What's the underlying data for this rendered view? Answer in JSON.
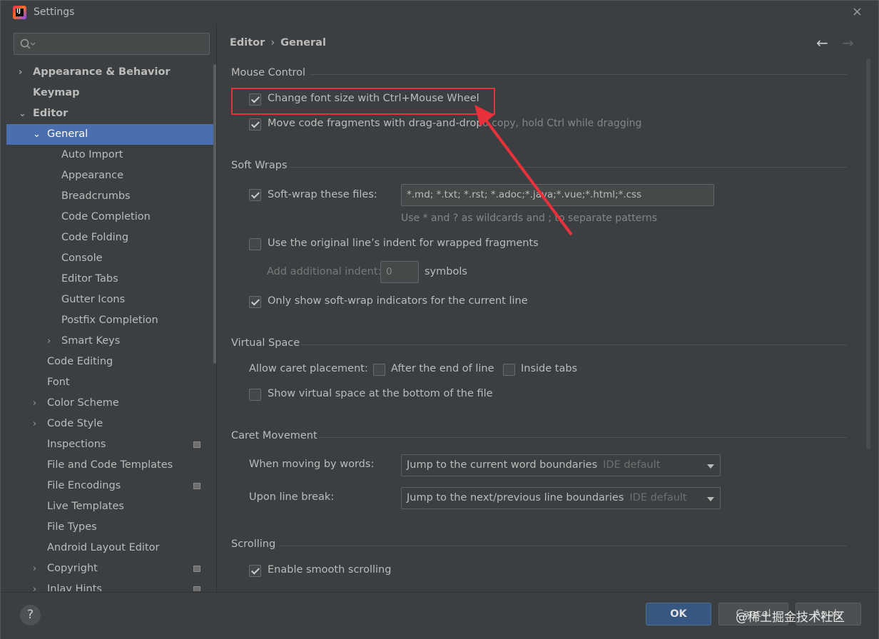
{
  "window": {
    "title": "Settings",
    "close": "×"
  },
  "search": {
    "placeholder": ""
  },
  "tree": [
    {
      "label": "Appearance & Behavior",
      "bold": true,
      "arrow": "›",
      "indent": 0
    },
    {
      "label": "Keymap",
      "bold": true,
      "indent": 0
    },
    {
      "label": "Editor",
      "bold": true,
      "arrow": "⌄",
      "indent": 0
    },
    {
      "label": "General",
      "arrow": "⌄",
      "indent": 1,
      "selected": true
    },
    {
      "label": "Auto Import",
      "indent": 2
    },
    {
      "label": "Appearance",
      "indent": 2
    },
    {
      "label": "Breadcrumbs",
      "indent": 2
    },
    {
      "label": "Code Completion",
      "indent": 2
    },
    {
      "label": "Code Folding",
      "indent": 2
    },
    {
      "label": "Console",
      "indent": 2
    },
    {
      "label": "Editor Tabs",
      "indent": 2
    },
    {
      "label": "Gutter Icons",
      "indent": 2
    },
    {
      "label": "Postfix Completion",
      "indent": 2
    },
    {
      "label": "Smart Keys",
      "arrow": "›",
      "indent": 2
    },
    {
      "label": "Code Editing",
      "indent": 1
    },
    {
      "label": "Font",
      "indent": 1
    },
    {
      "label": "Color Scheme",
      "arrow": "›",
      "indent": 1
    },
    {
      "label": "Code Style",
      "arrow": "›",
      "indent": 1
    },
    {
      "label": "Inspections",
      "indent": 1,
      "icon": true
    },
    {
      "label": "File and Code Templates",
      "indent": 1
    },
    {
      "label": "File Encodings",
      "indent": 1,
      "icon": true
    },
    {
      "label": "Live Templates",
      "indent": 1
    },
    {
      "label": "File Types",
      "indent": 1
    },
    {
      "label": "Android Layout Editor",
      "indent": 1
    },
    {
      "label": "Copyright",
      "arrow": "›",
      "indent": 1,
      "icon": true
    },
    {
      "label": "Inlay Hints",
      "arrow": "›",
      "indent": 1,
      "icon": true
    }
  ],
  "breadcrumb": {
    "root": "Editor",
    "sep": "›",
    "current": "General"
  },
  "nav": {
    "back": "←",
    "forward": "→"
  },
  "mouse_control": {
    "title": "Mouse Control",
    "font_size_ctrl_wheel": {
      "label": "Change font size with Ctrl+Mouse Wheel",
      "checked": true
    },
    "drag_drop": {
      "label": "Move code fragments with drag-and-drop",
      "hint": "To copy, hold Ctrl while dragging",
      "checked": true
    }
  },
  "soft_wraps": {
    "title": "Soft Wraps",
    "soft_wrap_files": {
      "label": "Soft-wrap these files:",
      "checked": true,
      "value": "*.md; *.txt; *.rst; *.adoc;*.java;*.vue;*.html;*.css",
      "hint": "Use * and ? as wildcards and ; to separate patterns"
    },
    "original_indent": {
      "label": "Use the original line’s indent for wrapped fragments",
      "checked": false
    },
    "additional_indent": {
      "label": "Add additional indent:",
      "value": "0",
      "suffix": "symbols"
    },
    "only_current_line": {
      "label": "Only show soft-wrap indicators for the current line",
      "checked": true
    }
  },
  "virtual_space": {
    "title": "Virtual Space",
    "allow_caret_label": "Allow caret placement:",
    "after_end": {
      "label": "After the end of line",
      "checked": false
    },
    "inside_tabs": {
      "label": "Inside tabs",
      "checked": false
    },
    "show_bottom": {
      "label": "Show virtual space at the bottom of the file",
      "checked": false
    }
  },
  "caret_movement": {
    "title": "Caret Movement",
    "by_words_label": "When moving by words:",
    "by_words_value": "Jump to the current word boundaries",
    "by_words_default": "IDE default",
    "line_break_label": "Upon line break:",
    "line_break_value": "Jump to the next/previous line boundaries",
    "line_break_default": "IDE default"
  },
  "scrolling": {
    "title": "Scrolling",
    "smooth": {
      "label": "Enable smooth scrolling",
      "checked": true
    }
  },
  "buttons": {
    "help": "?",
    "ok": "OK",
    "cancel": "Cancel",
    "apply": "Apply"
  },
  "watermark": "@稀土掘金技术社区",
  "colors": {
    "selection": "#4b6eaf",
    "highlight_box": "#e8313a",
    "ok_button": "#365880"
  }
}
